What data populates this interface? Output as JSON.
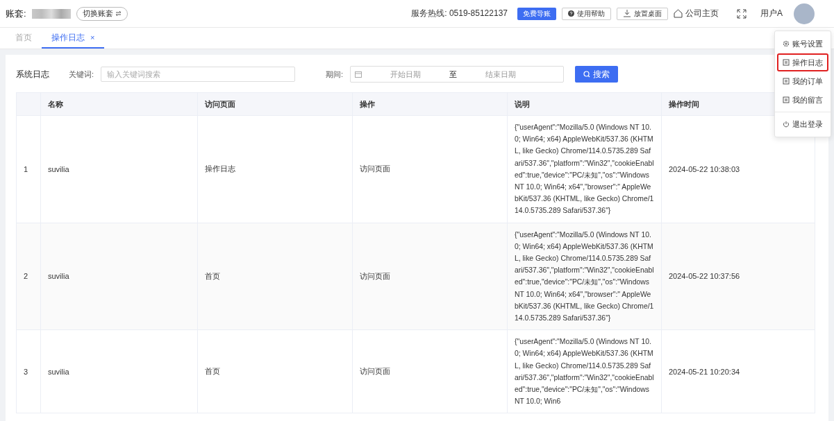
{
  "header": {
    "account_label": "账套:",
    "switch_button": "切换账套",
    "hotline": "服务热线: 0519-85122137",
    "free_button": "免费导账",
    "help_button": "使用帮助",
    "desktop_button": "放置桌面",
    "home_link": "公司主页",
    "user_name": "用户A"
  },
  "tabs": [
    {
      "label": "首页",
      "selected": false,
      "closable": false
    },
    {
      "label": "操作日志",
      "selected": true,
      "closable": true,
      "close": "×"
    }
  ],
  "user_menu": [
    {
      "kind": "gear",
      "label": "账号设置",
      "selected": false
    },
    {
      "kind": "doc",
      "label": "操作日志",
      "selected": true
    },
    {
      "kind": "doc",
      "label": "我的订单",
      "selected": false
    },
    {
      "kind": "doc",
      "label": "我的留言",
      "selected": false
    },
    {
      "kind": "power",
      "label": "退出登录",
      "selected": false
    }
  ],
  "filter": {
    "title": "系统日志",
    "keyword_label": "关键词:",
    "keyword_placeholder": "输入关键词搜索",
    "period_label": "期间:",
    "start_placeholder": "开始日期",
    "range_separator": "至",
    "end_placeholder": "结束日期",
    "search_button": "搜索"
  },
  "table": {
    "columns": [
      "名称",
      "访问页面",
      "操作",
      "说明",
      "操作时间"
    ],
    "rows": [
      {
        "index": "1",
        "name": "suvilia",
        "page": "操作日志",
        "action": "访问页面",
        "description": "{\"userAgent\":\"Mozilla/5.0 (Windows NT 10.0; Win64; x64) AppleWebKit/537.36 (KHTML, like Gecko) Chrome/114.0.5735.289 Safari/537.36\",\"platform\":\"Win32\",\"cookieEnabled\":true,\"device\":\"PC/未知\",\"os\":\"Windows NT 10.0; Win64; x64\",\"browser\":\" AppleWebKit/537.36 (KHTML, like Gecko) Chrome/114.0.5735.289 Safari/537.36\"}",
        "time": "2024-05-22 10:38:03"
      },
      {
        "index": "2",
        "name": "suvilia",
        "page": "首页",
        "action": "访问页面",
        "description": "{\"userAgent\":\"Mozilla/5.0 (Windows NT 10.0; Win64; x64) AppleWebKit/537.36 (KHTML, like Gecko) Chrome/114.0.5735.289 Safari/537.36\",\"platform\":\"Win32\",\"cookieEnabled\":true,\"device\":\"PC/未知\",\"os\":\"Windows NT 10.0; Win64; x64\",\"browser\":\" AppleWebKit/537.36 (KHTML, like Gecko) Chrome/114.0.5735.289 Safari/537.36\"}",
        "time": "2024-05-22 10:37:56"
      },
      {
        "index": "3",
        "name": "suvilia",
        "page": "首页",
        "action": "访问页面",
        "description": "{\"userAgent\":\"Mozilla/5.0 (Windows NT 10.0; Win64; x64) AppleWebKit/537.36 (KHTML, like Gecko) Chrome/114.0.5735.289 Safari/537.36\",\"platform\":\"Win32\",\"cookieEnabled\":true,\"device\":\"PC/未知\",\"os\":\"Windows NT 10.0; Win6",
        "time": "2024-05-21 10:20:34"
      }
    ]
  }
}
